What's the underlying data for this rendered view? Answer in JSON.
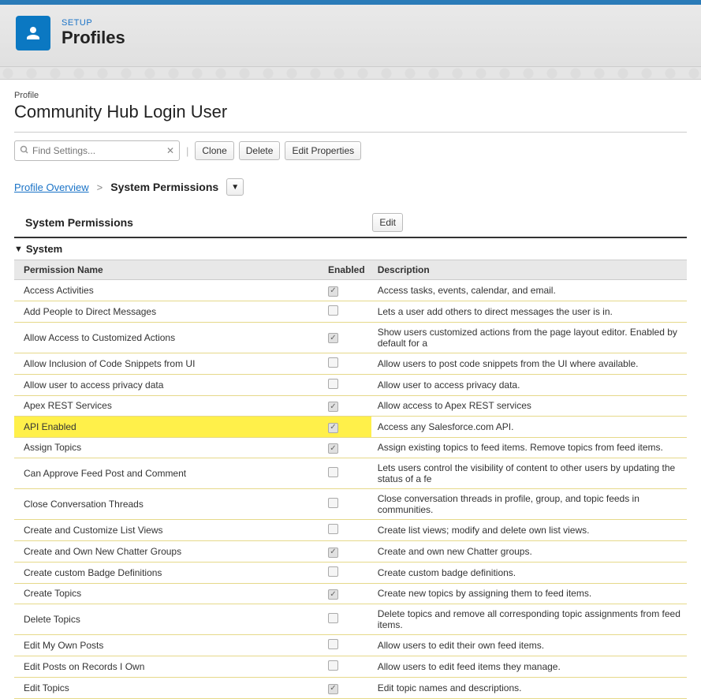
{
  "header": {
    "setup_label": "SETUP",
    "title": "Profiles"
  },
  "page": {
    "object_label": "Profile",
    "object_title": "Community Hub Login User"
  },
  "toolbar": {
    "search_placeholder": "Find Settings...",
    "clone": "Clone",
    "delete": "Delete",
    "edit_properties": "Edit Properties"
  },
  "breadcrumb": {
    "overview": "Profile Overview",
    "sep": ">",
    "current": "System Permissions"
  },
  "section": {
    "title": "System Permissions",
    "edit": "Edit",
    "group": "System"
  },
  "table": {
    "col_name": "Permission Name",
    "col_enabled": "Enabled",
    "col_desc": "Description",
    "rows": [
      {
        "name": "Access Activities",
        "enabled": true,
        "desc": "Access tasks, events, calendar, and email.",
        "highlight": false
      },
      {
        "name": "Add People to Direct Messages",
        "enabled": false,
        "desc": "Lets a user add others to direct messages the user is in.",
        "highlight": false
      },
      {
        "name": "Allow Access to Customized Actions",
        "enabled": true,
        "desc": "Show users customized actions from the page layout editor. Enabled by default for a",
        "highlight": false
      },
      {
        "name": "Allow Inclusion of Code Snippets from UI",
        "enabled": false,
        "desc": "Allow users to post code snippets from the UI where available.",
        "highlight": false
      },
      {
        "name": "Allow user to access privacy data",
        "enabled": false,
        "desc": "Allow user to access privacy data.",
        "highlight": false
      },
      {
        "name": "Apex REST Services",
        "enabled": true,
        "desc": "Allow access to Apex REST services",
        "highlight": false
      },
      {
        "name": "API Enabled",
        "enabled": true,
        "desc": "Access any Salesforce.com API.",
        "highlight": true
      },
      {
        "name": "Assign Topics",
        "enabled": true,
        "desc": "Assign existing topics to feed items. Remove topics from feed items.",
        "highlight": false
      },
      {
        "name": "Can Approve Feed Post and Comment",
        "enabled": false,
        "desc": "Lets users control the visibility of content to other users by updating the status of a fe",
        "highlight": false
      },
      {
        "name": "Close Conversation Threads",
        "enabled": false,
        "desc": "Close conversation threads in profile, group, and topic feeds in communities.",
        "highlight": false
      },
      {
        "name": "Create and Customize List Views",
        "enabled": false,
        "desc": "Create list views; modify and delete own list views.",
        "highlight": false
      },
      {
        "name": "Create and Own New Chatter Groups",
        "enabled": true,
        "desc": "Create and own new Chatter groups.",
        "highlight": false
      },
      {
        "name": "Create custom Badge Definitions",
        "enabled": false,
        "desc": "Create custom badge definitions.",
        "highlight": false
      },
      {
        "name": "Create Topics",
        "enabled": true,
        "desc": "Create new topics by assigning them to feed items.",
        "highlight": false
      },
      {
        "name": "Delete Topics",
        "enabled": false,
        "desc": "Delete topics and remove all corresponding topic assignments from feed items.",
        "highlight": false
      },
      {
        "name": "Edit My Own Posts",
        "enabled": false,
        "desc": "Allow users to edit their own feed items.",
        "highlight": false
      },
      {
        "name": "Edit Posts on Records I Own",
        "enabled": false,
        "desc": "Allow users to edit feed items they manage.",
        "highlight": false
      },
      {
        "name": "Edit Topics",
        "enabled": true,
        "desc": "Edit topic names and descriptions.",
        "highlight": false
      }
    ]
  }
}
